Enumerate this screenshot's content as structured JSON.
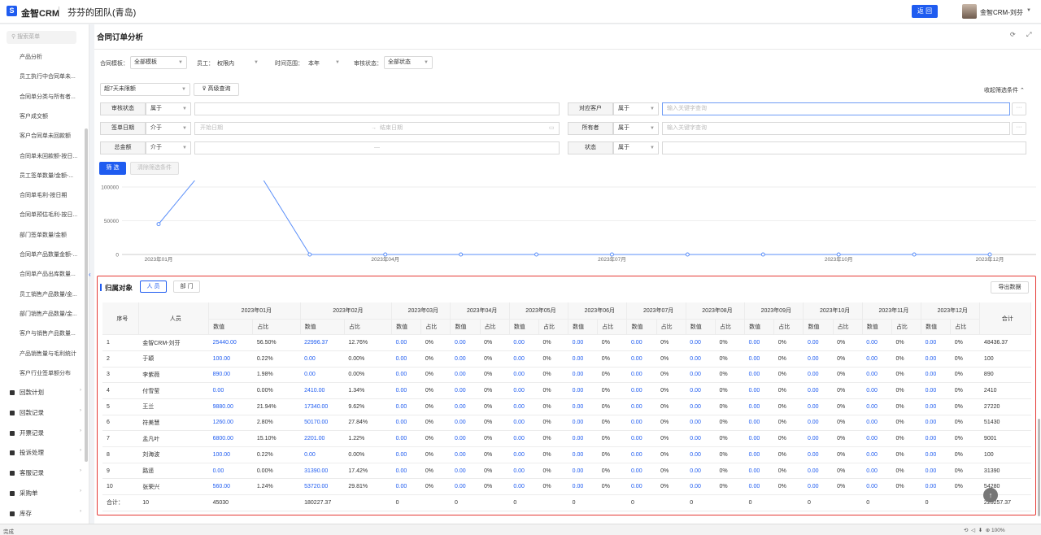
{
  "topbar": {
    "brand": "金智CRM",
    "team": "芬芬的团队(青岛)",
    "return_label": "返 回",
    "user_name": "金智CRM-刘芬"
  },
  "sidebar": {
    "search_placeholder": "搜索菜单",
    "items": [
      "产品分析",
      "员工执行中合同单未...",
      "合同单分类与所有者...",
      "客户成交额",
      "客户合同单未回款额",
      "合同单未回款额-按日...",
      "员工签单数量/金额-...",
      "合同单毛利-按日期",
      "合同单预估毛利-按日...",
      "部门签单数量/金额",
      "合同单产品数量金额-...",
      "合同单产品出库数量...",
      "员工销售产品数量/金...",
      "部门销售产品数量/金...",
      "客户与销售产品数量...",
      "产品销售量与毛利统计",
      "客户行业签单额分布"
    ],
    "groups": [
      "回款计划",
      "回款记录",
      "开票记录",
      "投诉处理",
      "客服记录",
      "采购单",
      "库存"
    ]
  },
  "page": {
    "title": "合同订单分析"
  },
  "filters": {
    "template_label": "合同模板：",
    "template_value": "全部模板",
    "employee_label": "员工：",
    "employee_value": "权限内",
    "range_label": "时间范围：",
    "range_value": "本年",
    "audit_label": "审核状态：",
    "audit_value": "全部状态",
    "overdue_value": "超7天未限额",
    "advanced_label": "高级查询",
    "collapse_label": "收起筛选条件",
    "conditions_left": [
      {
        "label": "审核状态",
        "op": "属于",
        "value": ""
      },
      {
        "label": "签单日期",
        "op": "介于",
        "start": "开始日期",
        "end": "结束日期"
      },
      {
        "label": "总金额",
        "op": "介于",
        "value": "—"
      }
    ],
    "conditions_right": [
      {
        "label": "对应客户",
        "op": "属于",
        "placeholder": "输入关键字查询"
      },
      {
        "label": "所有者",
        "op": "属于",
        "placeholder": "输入关键字查询"
      },
      {
        "label": "状态",
        "op": "属于",
        "value": ""
      }
    ],
    "submit_label": "筛 选",
    "clear_label": "清除筛选条件"
  },
  "chart_data": {
    "type": "line",
    "x": [
      "2023年01月",
      "2023年02月",
      "2023年03月",
      "2023年04月",
      "2023年05月",
      "2023年06月",
      "2023年07月",
      "2023年08月",
      "2023年09月",
      "2023年10月",
      "2023年11月",
      "2023年12月"
    ],
    "values": [
      45030,
      180227.37,
      0,
      0,
      0,
      0,
      0,
      0,
      0,
      0,
      0,
      0
    ],
    "y_ticks": [
      0,
      50000,
      100000
    ],
    "x_tick_labels": [
      "2023年01月",
      "2023年04月",
      "2023年07月",
      "2023年10月",
      "2023年12月"
    ],
    "color": "#5b8ff9",
    "ylim": [
      0,
      100000
    ]
  },
  "table": {
    "section_title": "归属对象",
    "tabs": [
      "人 员",
      "部 门"
    ],
    "export_label": "导出数据",
    "col_index": "序号",
    "col_person": "人员",
    "col_total": "合计",
    "sub_value": "数值",
    "sub_ratio": "占比",
    "months": [
      "2023年01月",
      "2023年02月",
      "2023年03月",
      "2023年04月",
      "2023年05月",
      "2023年06月",
      "2023年07月",
      "2023年08月",
      "2023年09月",
      "2023年10月",
      "2023年11月",
      "2023年12月"
    ],
    "rows": [
      {
        "idx": "1",
        "name": "金智CRM-刘芬",
        "m1": [
          "25440.00",
          "56.50%"
        ],
        "m2": [
          "22996.37",
          "12.76%"
        ],
        "total": "48436.37"
      },
      {
        "idx": "2",
        "name": "于颖",
        "m1": [
          "100.00",
          "0.22%"
        ],
        "m2": [
          "0.00",
          "0.00%"
        ],
        "total": "100"
      },
      {
        "idx": "3",
        "name": "李紫薇",
        "m1": [
          "890.00",
          "1.98%"
        ],
        "m2": [
          "0.00",
          "0.00%"
        ],
        "total": "890"
      },
      {
        "idx": "4",
        "name": "付雪莹",
        "m1": [
          "0.00",
          "0.00%"
        ],
        "m2": [
          "2410.00",
          "1.34%"
        ],
        "total": "2410"
      },
      {
        "idx": "5",
        "name": "王兰",
        "m1": [
          "9880.00",
          "21.94%"
        ],
        "m2": [
          "17340.00",
          "9.62%"
        ],
        "total": "27220"
      },
      {
        "idx": "6",
        "name": "符美慧",
        "m1": [
          "1260.00",
          "2.80%"
        ],
        "m2": [
          "50170.00",
          "27.84%"
        ],
        "total": "51430"
      },
      {
        "idx": "7",
        "name": "孟凡叶",
        "m1": [
          "6800.00",
          "15.10%"
        ],
        "m2": [
          "2201.00",
          "1.22%"
        ],
        "total": "9001"
      },
      {
        "idx": "8",
        "name": "刘海波",
        "m1": [
          "100.00",
          "0.22%"
        ],
        "m2": [
          "0.00",
          "0.00%"
        ],
        "total": "100"
      },
      {
        "idx": "9",
        "name": "路遥",
        "m1": [
          "0.00",
          "0.00%"
        ],
        "m2": [
          "31390.00",
          "17.42%"
        ],
        "total": "31390"
      },
      {
        "idx": "10",
        "name": "张荣兴",
        "m1": [
          "560.00",
          "1.24%"
        ],
        "m2": [
          "53720.00",
          "29.81%"
        ],
        "total": "54280"
      }
    ],
    "zero_value": "0.00",
    "zero_ratio": "0%",
    "sum_row": {
      "label": "合计：",
      "count": "10",
      "m1": "45030",
      "m2": "180227.37",
      "rest": "0",
      "total": "225257.37"
    }
  },
  "statusbar": {
    "left": "完成",
    "zoom": "100%"
  }
}
